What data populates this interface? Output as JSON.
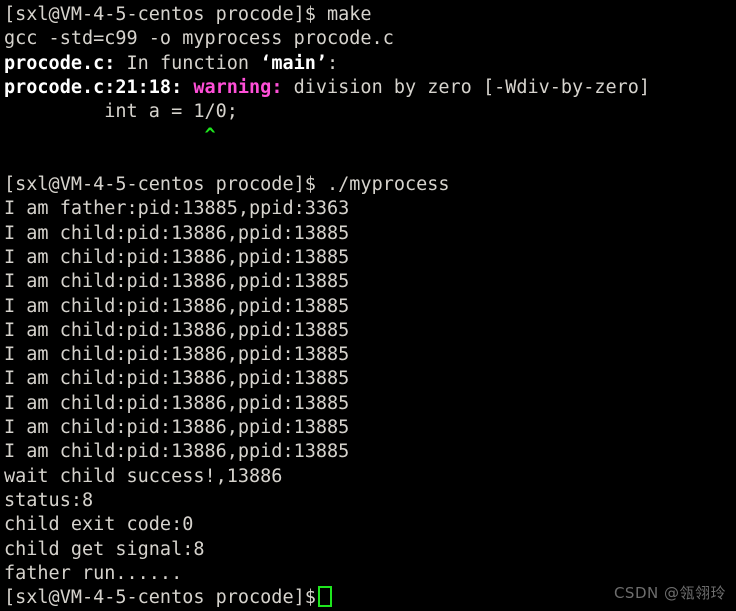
{
  "terminal": {
    "background_color": "#000000",
    "foreground_color": "#d6d3cd",
    "warning_color": "#ff4fd8",
    "caret_color": "#1ee61e",
    "cursor_color": "#1ee61e",
    "prompt": "[sxl@VM-4-5-centos procode]$ ",
    "lines": [
      {
        "id": "cmd-make",
        "segments": [
          {
            "text": "[sxl@VM-4-5-centos procode]$ ",
            "style": "plain"
          },
          {
            "text": "make",
            "style": "plain"
          }
        ]
      },
      {
        "id": "gcc-command",
        "segments": [
          {
            "text": "gcc -std=c99 -o myprocess procode.c",
            "style": "plain"
          }
        ]
      },
      {
        "id": "gcc-in-function",
        "segments": [
          {
            "text": "procode.c:",
            "style": "bold-white"
          },
          {
            "text": " In function ",
            "style": "plain"
          },
          {
            "text": "‘main’",
            "style": "bold-white"
          },
          {
            "text": ":",
            "style": "plain"
          }
        ]
      },
      {
        "id": "gcc-warning",
        "segments": [
          {
            "text": "procode.c:21:18:",
            "style": "bold-white"
          },
          {
            "text": " ",
            "style": "plain"
          },
          {
            "text": "warning:",
            "style": "warn"
          },
          {
            "text": " division by zero [-Wdiv-by-zero]",
            "style": "plain"
          }
        ]
      },
      {
        "id": "gcc-source-snippet",
        "segments": [
          {
            "text": "         int a = 1/0;",
            "style": "plain"
          }
        ]
      },
      {
        "id": "gcc-caret-marker",
        "segments": [
          {
            "text": "                  ",
            "style": "plain"
          },
          {
            "text": "^",
            "style": "caret-green"
          }
        ]
      },
      {
        "id": "blank-1",
        "segments": [
          {
            "text": " ",
            "style": "plain"
          }
        ]
      },
      {
        "id": "cmd-run-myprocess",
        "segments": [
          {
            "text": "[sxl@VM-4-5-centos procode]$ ",
            "style": "plain"
          },
          {
            "text": "./myprocess",
            "style": "plain"
          }
        ]
      },
      {
        "id": "out-father",
        "segments": [
          {
            "text": "I am father:pid:13885,ppid:3363",
            "style": "plain"
          }
        ]
      },
      {
        "id": "out-child-1",
        "segments": [
          {
            "text": "I am child:pid:13886,ppid:13885",
            "style": "plain"
          }
        ]
      },
      {
        "id": "out-child-2",
        "segments": [
          {
            "text": "I am child:pid:13886,ppid:13885",
            "style": "plain"
          }
        ]
      },
      {
        "id": "out-child-3",
        "segments": [
          {
            "text": "I am child:pid:13886,ppid:13885",
            "style": "plain"
          }
        ]
      },
      {
        "id": "out-child-4",
        "segments": [
          {
            "text": "I am child:pid:13886,ppid:13885",
            "style": "plain"
          }
        ]
      },
      {
        "id": "out-child-5",
        "segments": [
          {
            "text": "I am child:pid:13886,ppid:13885",
            "style": "plain"
          }
        ]
      },
      {
        "id": "out-child-6",
        "segments": [
          {
            "text": "I am child:pid:13886,ppid:13885",
            "style": "plain"
          }
        ]
      },
      {
        "id": "out-child-7",
        "segments": [
          {
            "text": "I am child:pid:13886,ppid:13885",
            "style": "plain"
          }
        ]
      },
      {
        "id": "out-child-8",
        "segments": [
          {
            "text": "I am child:pid:13886,ppid:13885",
            "style": "plain"
          }
        ]
      },
      {
        "id": "out-child-9",
        "segments": [
          {
            "text": "I am child:pid:13886,ppid:13885",
            "style": "plain"
          }
        ]
      },
      {
        "id": "out-child-10",
        "segments": [
          {
            "text": "I am child:pid:13886,ppid:13885",
            "style": "plain"
          }
        ]
      },
      {
        "id": "out-wait-child",
        "segments": [
          {
            "text": "wait child success!,13886",
            "style": "plain"
          }
        ]
      },
      {
        "id": "out-status",
        "segments": [
          {
            "text": "status:8",
            "style": "plain"
          }
        ]
      },
      {
        "id": "out-child-exit-code",
        "segments": [
          {
            "text": "child exit code:0",
            "style": "plain"
          }
        ]
      },
      {
        "id": "out-child-get-signal",
        "segments": [
          {
            "text": "child get signal:8",
            "style": "plain"
          }
        ]
      },
      {
        "id": "out-father-run",
        "segments": [
          {
            "text": "father run......",
            "style": "plain"
          }
        ]
      },
      {
        "id": "prompt-final",
        "cursor": true,
        "segments": [
          {
            "text": "[sxl@VM-4-5-centos procode]$",
            "style": "plain"
          }
        ]
      }
    ]
  },
  "watermark": {
    "text": "CSDN @瓴翎玲"
  }
}
